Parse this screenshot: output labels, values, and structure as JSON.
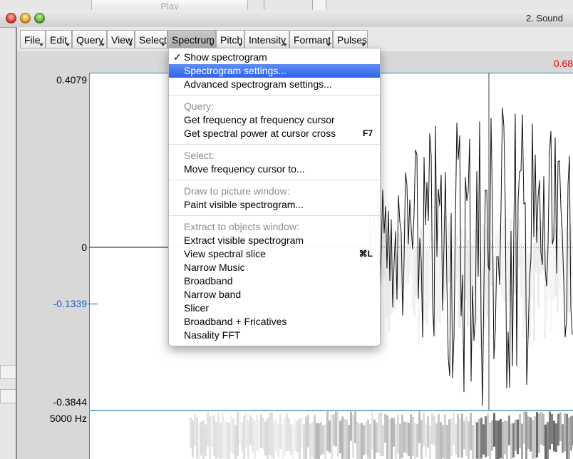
{
  "background_window": {
    "play_button_label": "Play"
  },
  "window": {
    "title": "2. Sound"
  },
  "menubar": {
    "items": [
      "File",
      "Edit",
      "Query",
      "View",
      "Select",
      "Spectrum",
      "Pitch",
      "Intensity",
      "Formant",
      "Pulses"
    ],
    "active": "Spectrum"
  },
  "editor": {
    "cursor_time": "0.68",
    "y_max": "0.4079",
    "y_zero": "0",
    "y_cursor": "-0.1339",
    "y_min": "-0.3844",
    "spectrogram_top": "5000 Hz"
  },
  "spectrum_menu": {
    "show_spectrogram": "Show spectrogram",
    "spectrogram_settings": "Spectrogram settings...",
    "advanced_settings": "Advanced spectrogram settings...",
    "query_header": "Query:",
    "get_frequency": "Get frequency at frequency cursor",
    "get_spectral_power": "Get spectral power at cursor cross",
    "get_spectral_power_shortcut": "F7",
    "select_header": "Select:",
    "move_frequency_cursor": "Move frequency cursor to...",
    "draw_header": "Draw to picture window:",
    "paint_visible": "Paint visible spectrogram...",
    "extract_header": "Extract to objects window:",
    "extract_visible": "Extract visible spectrogram",
    "view_spectral_slice": "View spectral slice",
    "view_spectral_slice_shortcut": "⌘L",
    "narrow_music": "Narrow Music",
    "broadband": "Broadband",
    "narrow_band": "Narrow band",
    "slicer": "Slicer",
    "broadband_fricatives": "Broadband + Fricatives",
    "nasality_fft": "Nasality FFT"
  },
  "colors": {
    "selection": "#2f63e8",
    "cursor_time": "#e00000",
    "axis_blue": "#1a5fd0",
    "frame_blue": "#1a8fbf"
  }
}
